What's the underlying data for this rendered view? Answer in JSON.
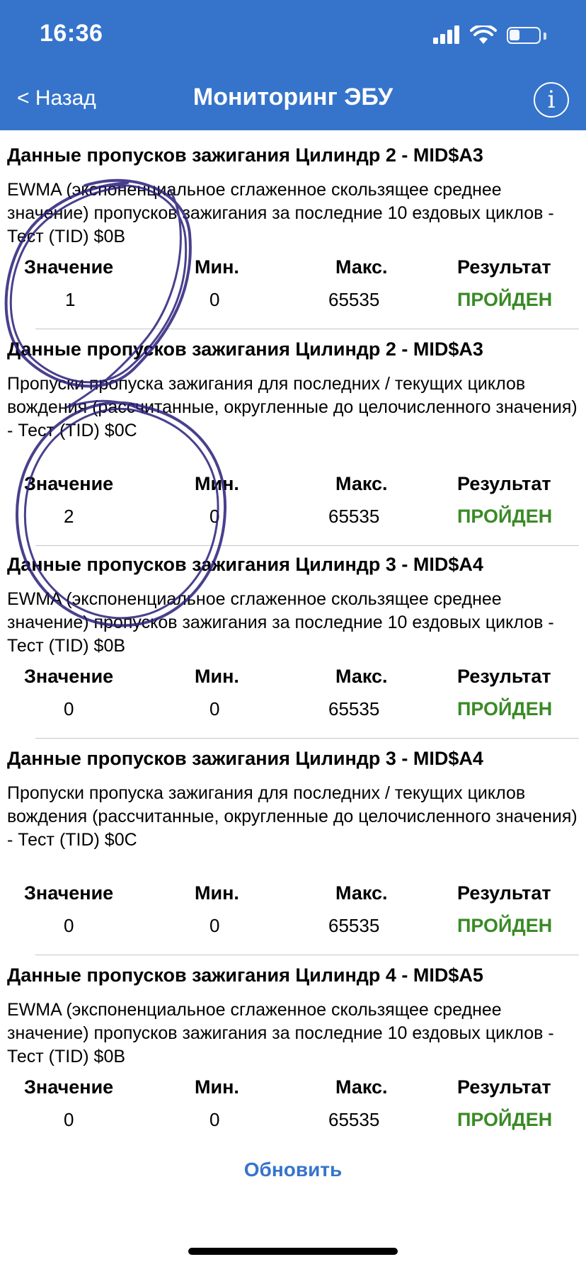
{
  "status_bar": {
    "time": "16:36"
  },
  "nav": {
    "back_label": "< Назад",
    "title": "Мониторинг ЭБУ",
    "info_label": "i"
  },
  "columns": {
    "value": "Значение",
    "min": "Мин.",
    "max": "Макс.",
    "result": "Результат"
  },
  "sections": [
    {
      "title": "Данные пропусков зажигания Цилиндр 2 - MID$A3",
      "desc": "EWMA (экспоненциальное сглаженное скользящее среднее значение) пропусков зажигания за последние 10 ездовых циклов - Тест (TID) $0B",
      "value": "1",
      "min": "0",
      "max": "65535",
      "result": "ПРОЙДЕН"
    },
    {
      "title": "Данные пропусков зажигания Цилиндр 2 - MID$A3",
      "desc": "Пропуски пропуска зажигания для последних / текущих циклов вождения (рассчитанные, округленные до целочисленного значения) - Тест (TID) $0C",
      "value": "2",
      "min": "0",
      "max": "65535",
      "result": "ПРОЙДЕН"
    },
    {
      "title": "Данные пропусков зажигания Цилиндр 3 - MID$A4",
      "desc": "EWMA (экспоненциальное сглаженное скользящее среднее значение) пропусков зажигания за последние 10 ездовых циклов - Тест (TID) $0B",
      "value": "0",
      "min": "0",
      "max": "65535",
      "result": "ПРОЙДЕН"
    },
    {
      "title": "Данные пропусков зажигания Цилиндр 3 - MID$A4",
      "desc": "Пропуски пропуска зажигания для последних / текущих циклов вождения (рассчитанные, округленные до целочисленного значения) - Тест (TID) $0C",
      "value": "0",
      "min": "0",
      "max": "65535",
      "result": "ПРОЙДЕН"
    },
    {
      "title": "Данные пропусков зажигания Цилиндр 4 - MID$A5",
      "desc": "EWMA (экспоненциальное сглаженное скользящее среднее значение) пропусков зажигания за последние 10 ездовых циклов - Тест (TID) $0B",
      "value": "0",
      "min": "0",
      "max": "65535",
      "result": "ПРОЙДЕН"
    }
  ],
  "refresh_label": "Обновить",
  "colors": {
    "header": "#3674cb",
    "pass": "#3a8a26",
    "link": "#3674cb",
    "scribble": "#2a1f7a"
  }
}
